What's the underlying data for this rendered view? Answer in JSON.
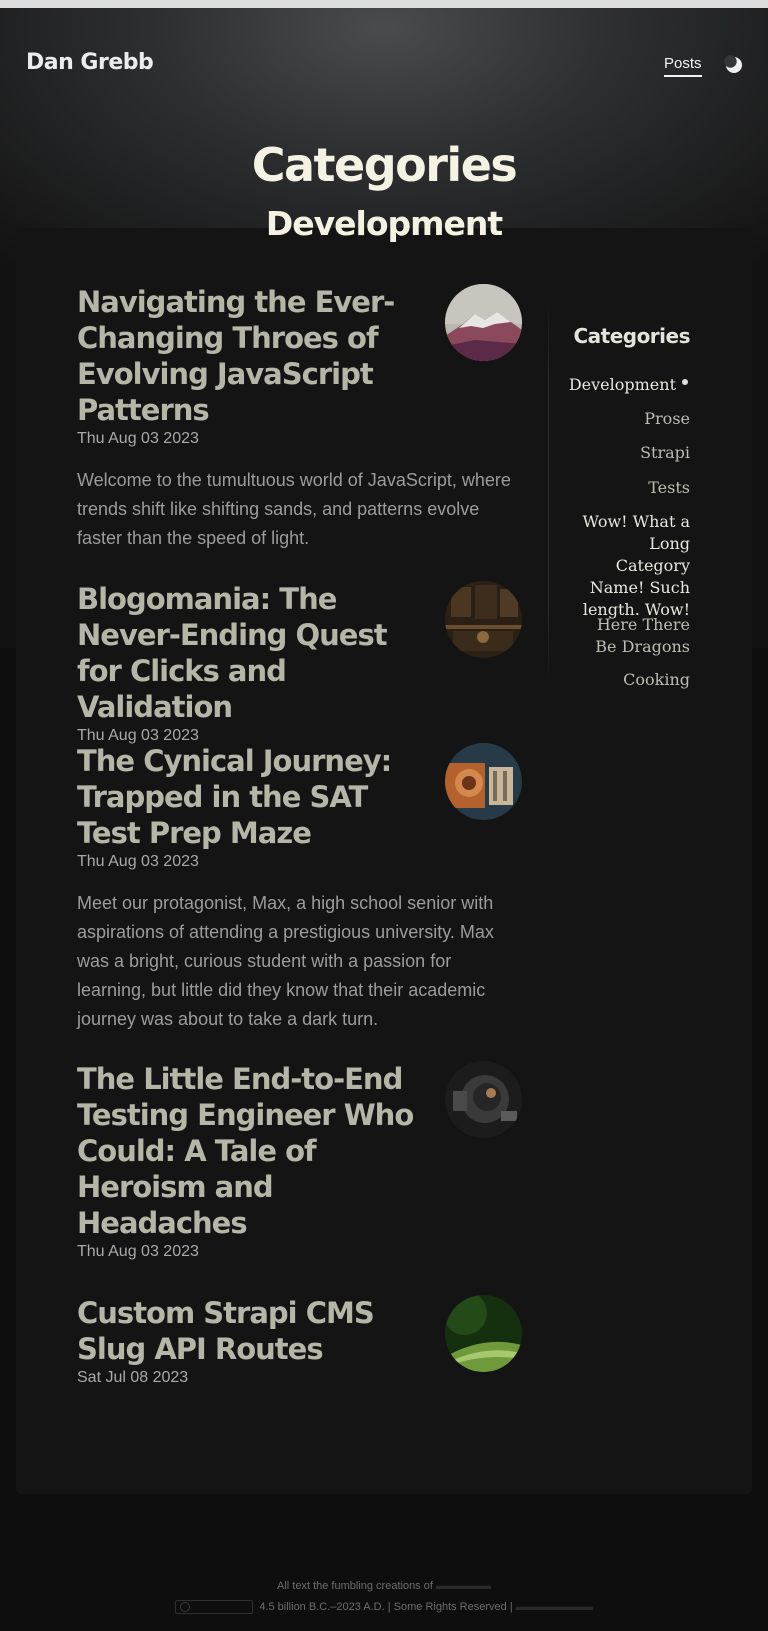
{
  "site": {
    "name": "Dan Grebb"
  },
  "nav": {
    "posts_label": "Posts",
    "theme_icon": "moon-icon"
  },
  "page": {
    "title": "Categories",
    "subtitle": "Development"
  },
  "posts": [
    {
      "title": "Navigating the Ever-Changing Throes of Evolving JavaScript Patterns",
      "date": "Thu Aug 03 2023",
      "excerpt": "Welcome to the tumultuous world of JavaScript, where trends shift like shifting sands, and patterns evolve faster than the speed of light.",
      "thumb": "snowy-mountain-thumbnail"
    },
    {
      "title": "Blogomania: The Never-Ending Quest for Clicks and Validation",
      "date": "Thu Aug 03 2023",
      "excerpt": "",
      "thumb": "library-desk-thumbnail"
    },
    {
      "title": "The Cynical Journey: Trapped in the SAT Test Prep Maze",
      "date": "Thu Aug 03 2023",
      "excerpt": "Meet our protagonist, Max, a high school senior with aspirations of attending a prestigious university. Max was a bright, curious student with a passion for learning, but little did they know that their academic journey was about to take a dark turn.",
      "thumb": "machinery-thumbnail"
    },
    {
      "title": "The Little End-to-End Testing Engineer Who Could: A Tale of Heroism and Headaches",
      "date": "Thu Aug 03 2023",
      "excerpt": "",
      "thumb": "robot-thumbnail"
    },
    {
      "title": "Custom Strapi CMS Slug API Routes",
      "date": "Sat Jul 08 2023",
      "excerpt": "",
      "thumb": "leaf-thumbnail"
    }
  ],
  "sidebar": {
    "heading": "Categories",
    "categories": [
      {
        "label": "Development",
        "active": true
      },
      {
        "label": "Prose",
        "active": false
      },
      {
        "label": "Strapi",
        "active": false
      },
      {
        "label": "Tests",
        "active": false
      },
      {
        "label": "Wow! What a Long Category Name! Such length. Wow!",
        "active": false
      },
      {
        "label": "Here There Be Dragons",
        "active": false
      },
      {
        "label": "Cooking",
        "active": false
      }
    ]
  },
  "footer": {
    "line1": "All text the fumbling creations of",
    "line2": "4.5 billion B.C.–2023 A.D. | Some Rights Reserved |",
    "license_badge": "cc-by-nc-icon"
  }
}
